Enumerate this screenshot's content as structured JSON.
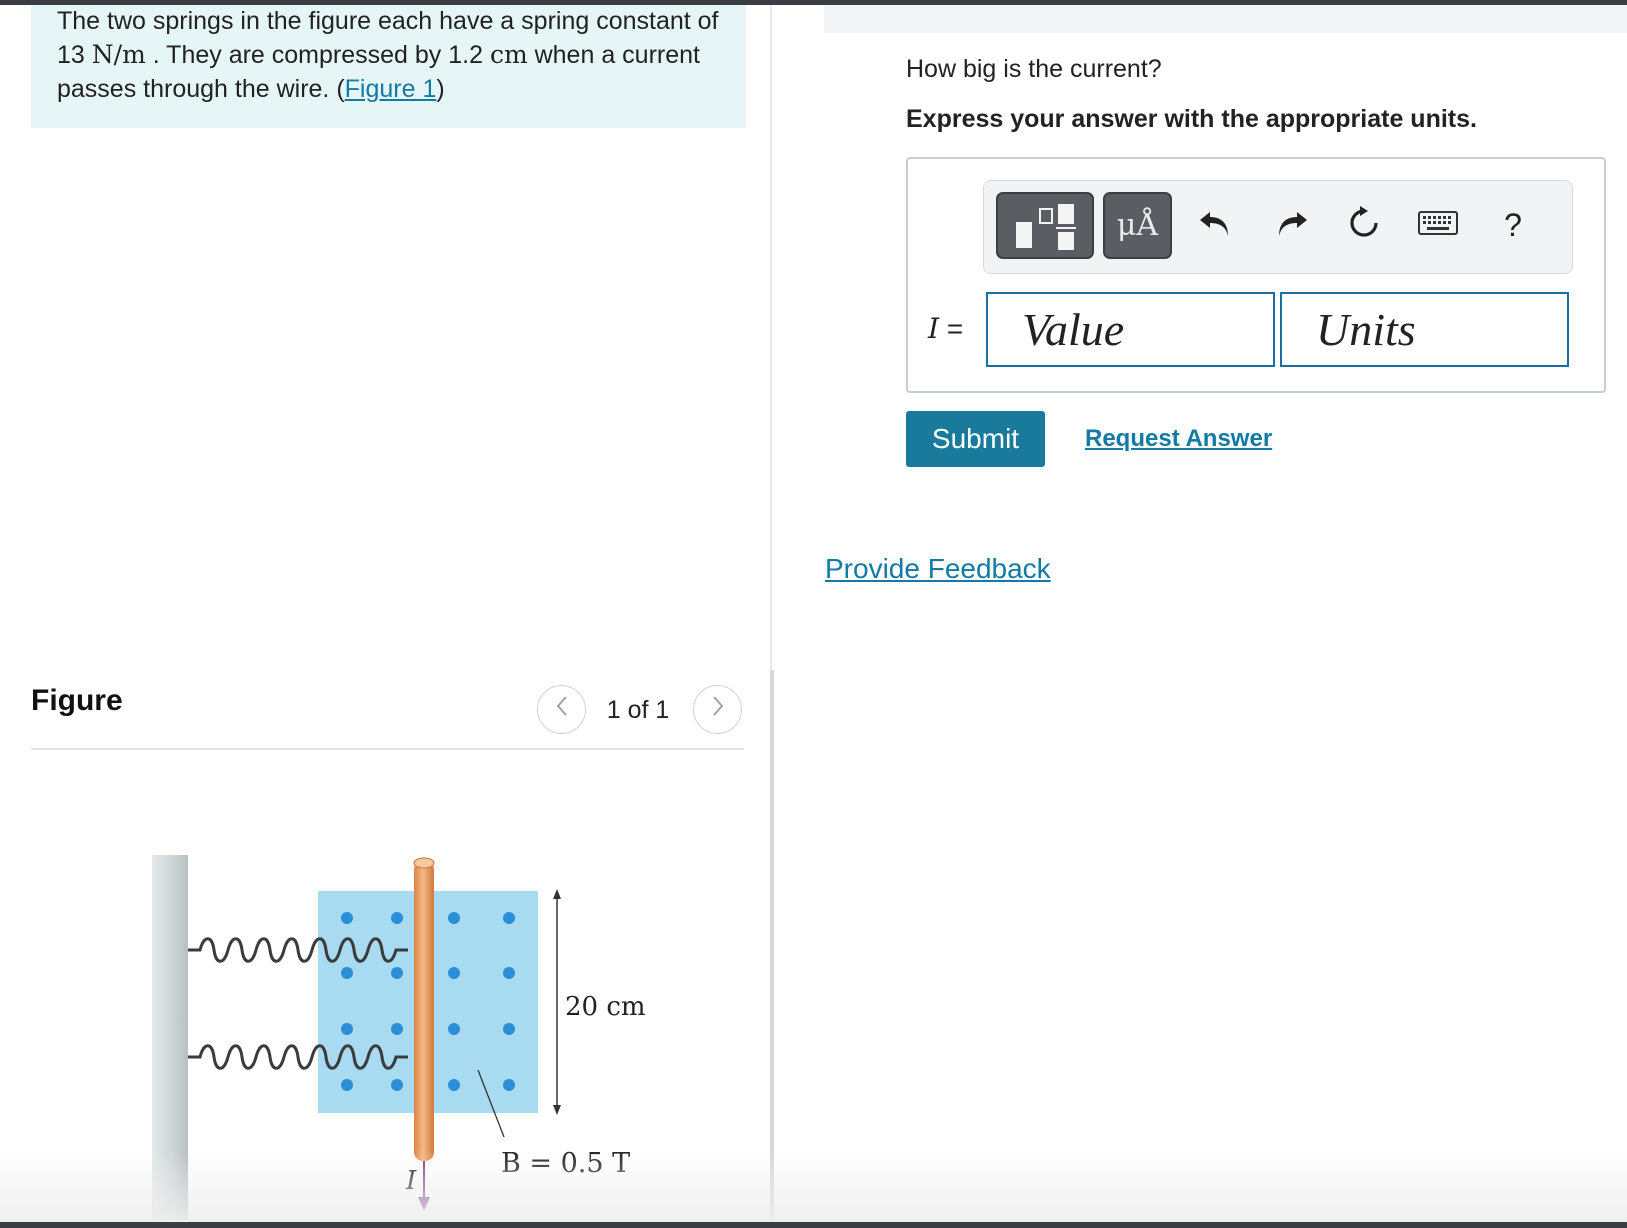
{
  "problem": {
    "text_1": "The two springs in the figure each have a spring constant of 13 ",
    "spring_constant_unit": "N/m",
    "text_2": " . They are compressed by 1.2 ",
    "compression_unit": "cm",
    "text_3": " when a current passes through the wire. (",
    "figure_link": "Figure 1",
    "text_4": ")"
  },
  "figure_panel": {
    "title": "Figure",
    "pager": "1 of 1",
    "prev_icon": "chevron-left-icon",
    "next_icon": "chevron-right-icon"
  },
  "figure": {
    "length_label": "20 cm",
    "field_label": "B = 0.5 T",
    "current_label": "I",
    "colors": {
      "field_region": "#a8daf2",
      "field_dot": "#2a8fd6",
      "wire": "#f2a56b",
      "wall": "#ccd3d4",
      "current_arrow": "#7a3d8f"
    }
  },
  "question": {
    "prompt": "How big is the current?",
    "instruction": "Express your answer with the appropriate units."
  },
  "answer": {
    "variable": "I",
    "equals": "=",
    "value_placeholder": "Value",
    "units_placeholder": "Units",
    "value": "",
    "units": ""
  },
  "toolbar": {
    "units_button": "μÅ",
    "template_icon": "fraction-template-icon",
    "undo_icon": "undo-icon",
    "redo_icon": "redo-icon",
    "reset_icon": "reset-icon",
    "keyboard_icon": "keyboard-icon",
    "help": "?"
  },
  "actions": {
    "submit": "Submit",
    "request_answer": "Request Answer",
    "feedback": "Provide Feedback"
  },
  "colors": {
    "accent": "#1a7a9c",
    "link": "#127aa5",
    "problem_bg": "#e6f6f7",
    "input_border": "#1c6da0"
  }
}
